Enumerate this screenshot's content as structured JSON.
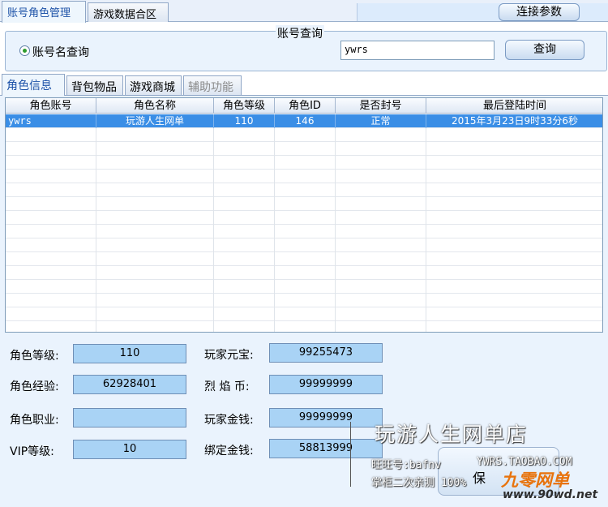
{
  "top_tabs": [
    {
      "label": "账号角色管理",
      "active": true
    },
    {
      "label": "游戏数据合区",
      "active": false
    }
  ],
  "connect_button": "连接参数",
  "query": {
    "group_title": "账号查询",
    "radio_label": "账号名查询",
    "input_value": "ywrs",
    "button_label": "查询"
  },
  "inner_tabs": [
    {
      "label": "角色信息",
      "active": true,
      "disabled": false
    },
    {
      "label": "背包物品",
      "active": false,
      "disabled": false
    },
    {
      "label": "游戏商城",
      "active": false,
      "disabled": false
    },
    {
      "label": "辅助功能",
      "active": false,
      "disabled": true
    }
  ],
  "table": {
    "columns": [
      "角色账号",
      "角色名称",
      "角色等级",
      "角色ID",
      "是否封号",
      "最后登陆时间"
    ],
    "rows": [
      [
        "ywrs",
        "玩游人生网单",
        "110",
        "146",
        "正常",
        "2015年3月23日9时33分6秒"
      ]
    ]
  },
  "details": {
    "level_label": "角色等级:",
    "level_value": "110",
    "exp_label": "角色经验:",
    "exp_value": "62928401",
    "job_label": "角色职业:",
    "job_value": "",
    "vip_label": "VIP等级:",
    "vip_value": "10",
    "yuanbao_label": "玩家元宝:",
    "yuanbao_value": "99255473",
    "flame_label": "烈 焰 币:",
    "flame_value": "99999999",
    "gold_label": "玩家金钱:",
    "gold_value": "99999999",
    "bound_gold_label": "绑定金钱:",
    "bound_gold_value": "58813999"
  },
  "watermark": {
    "title": "玩游人生网单店",
    "line1": "旺旺号:bafnv",
    "line1_right": "YWRS.TAOBAO.COM",
    "line2": "掌柜二次亲测 100%",
    "ghost_button": "保",
    "logo": "九零网单",
    "url": "www.90wd.net"
  },
  "colors": {
    "panel_bg": "#eaf3fd",
    "selected_row": "#3a8ee6",
    "field_bg": "#a9d3f5",
    "active_tab_text": "#1d52a8",
    "logo_orange": "#e8730c"
  }
}
